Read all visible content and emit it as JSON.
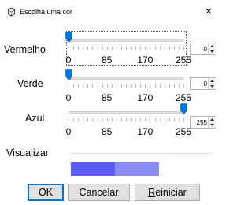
{
  "window": {
    "title": "Escolha uma cor",
    "close_glyph": "×",
    "icon": "color-wheel-icon"
  },
  "channels": [
    {
      "label": "Vermelho",
      "value": "0",
      "fraction": 0.0,
      "color": "#ff0000"
    },
    {
      "label": "Verde",
      "value": "0",
      "fraction": 0.0,
      "color": "#00ff00"
    },
    {
      "label": "Azul",
      "value": "255",
      "fraction": 1.0,
      "color": "#0000ff"
    }
  ],
  "slider_scale": {
    "tick_labels": [
      "0",
      "85",
      "170",
      "255"
    ],
    "min": 0,
    "max": 255
  },
  "preview": {
    "label": "Visualizar",
    "current_color": "#5b5bf5",
    "previous_color": "#8c8cf5"
  },
  "buttons": {
    "ok": "OK",
    "cancel": "Cancelar",
    "reset_mnemonic": "R",
    "reset_rest": "einiciar"
  },
  "colors": {
    "accent": "#0078d7",
    "button_face": "#e1e1e1"
  }
}
